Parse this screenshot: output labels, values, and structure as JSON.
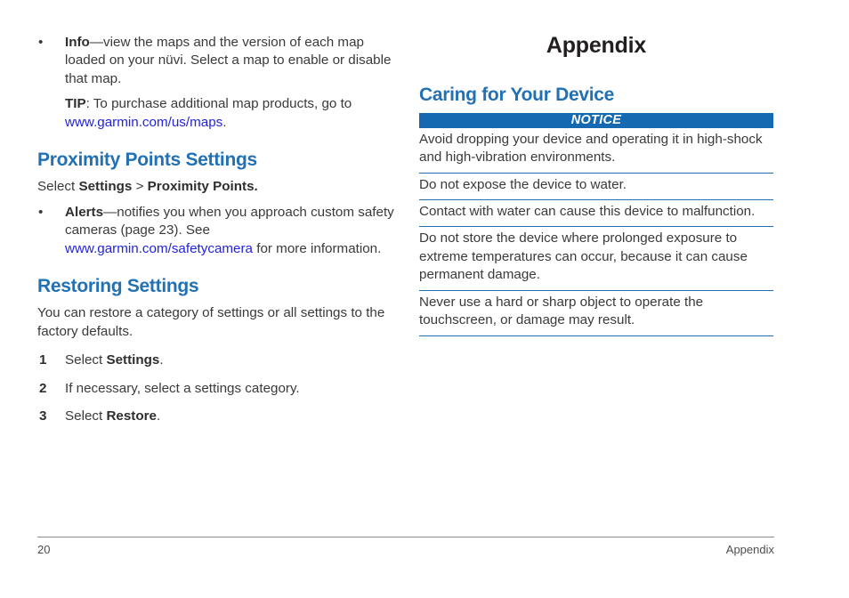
{
  "document": {
    "title": "Appendix"
  },
  "left_column": {
    "info_bullet": {
      "marker": "•",
      "term": "Info",
      "text": "—view the maps and the version of each map loaded on your nüvi. Select a map to enable or disable that map."
    },
    "tip": {
      "label": "TIP",
      "text_before": ": To purchase additional map products, go to ",
      "link": "www.garmin.com/us/maps",
      "text_after": "."
    },
    "proximity_section": {
      "heading": "Proximity Points Settings",
      "select_prefix": "Select ",
      "select_bold_1": "Settings",
      "select_sep": " > ",
      "select_bold_2": "Proximity Points.",
      "alerts_bullet": {
        "marker": "•",
        "term": "Alerts",
        "text_before": "—notifies you when you approach custom safety cameras (page 23). See ",
        "link": "www.garmin.com/safetycamera",
        "text_after": " for more information."
      }
    },
    "restoring_section": {
      "heading": "Restoring Settings",
      "intro": "You can restore a category of settings or all settings to the factory defaults.",
      "steps": [
        {
          "num": "1",
          "prefix": "Select ",
          "bold": "Settings",
          "suffix": "."
        },
        {
          "num": "2",
          "prefix": "If necessary, select a settings category.",
          "bold": "",
          "suffix": ""
        },
        {
          "num": "3",
          "prefix": "Select ",
          "bold": "Restore",
          "suffix": "."
        }
      ]
    }
  },
  "right_column": {
    "caring_section": {
      "heading": "Caring for Your Device",
      "notice_label": "NOTICE",
      "notices": [
        "Avoid dropping your device and operating it in high-shock and high-vibration environments.",
        "Do not expose the device to water.",
        "Contact with water can cause this device to malfunction.",
        "Do not store the device where prolonged exposure to extreme temperatures can occur, because it can cause permanent damage.",
        "Never use a hard or sharp object to operate the touchscreen, or damage may result."
      ]
    }
  },
  "footer": {
    "page_number": "20",
    "section_label": "Appendix"
  },
  "colors": {
    "heading_blue": "#2271b5",
    "notice_bar_blue": "#1569b0",
    "link_blue": "#2323dd",
    "body_gray": "#3a3a3a",
    "title_black": "#231f20",
    "footer_gray": "#4d4d4d"
  }
}
